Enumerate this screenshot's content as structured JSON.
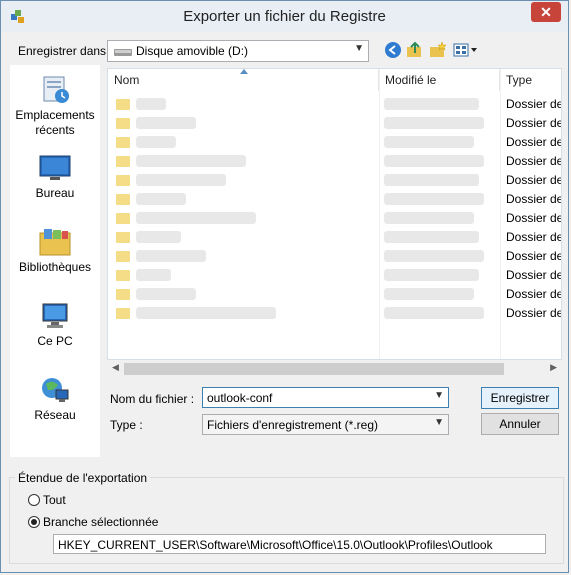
{
  "window": {
    "title": "Exporter un fichier du Registre",
    "close_glyph": "✕"
  },
  "location": {
    "label": "Enregistrer dans :",
    "value": "Disque amovible (D:)"
  },
  "toolbar": {
    "icons": [
      "back-icon",
      "up-folder-icon",
      "new-folder-icon",
      "views-icon"
    ]
  },
  "places": [
    {
      "label": "Emplacements récents",
      "icon": "recent-places-icon"
    },
    {
      "label": "Bureau",
      "icon": "desktop-icon"
    },
    {
      "label": "Bibliothèques",
      "icon": "libraries-icon"
    },
    {
      "label": "Ce PC",
      "icon": "computer-icon"
    },
    {
      "label": "Réseau",
      "icon": "network-icon"
    }
  ],
  "file_list": {
    "columns": [
      "Nom",
      "Modifié le",
      "Type"
    ],
    "row_type": "Dossier de",
    "row_count": 12
  },
  "filename": {
    "label": "Nom du fichier :",
    "value": "outlook-conf"
  },
  "filetype": {
    "label": "Type :",
    "value": "Fichiers d'enregistrement (*.reg)"
  },
  "buttons": {
    "save": "Enregistrer",
    "cancel": "Annuler"
  },
  "export_range": {
    "title": "Étendue de l'exportation",
    "option_all": "Tout",
    "option_branch": "Branche sélectionnée",
    "selected": "branch",
    "branch_path": "HKEY_CURRENT_USER\\Software\\Microsoft\\Office\\15.0\\Outlook\\Profiles\\Outlook"
  },
  "colors": {
    "accent": "#3c7fb1",
    "close": "#c7443a",
    "folder": "#f5dc86"
  }
}
